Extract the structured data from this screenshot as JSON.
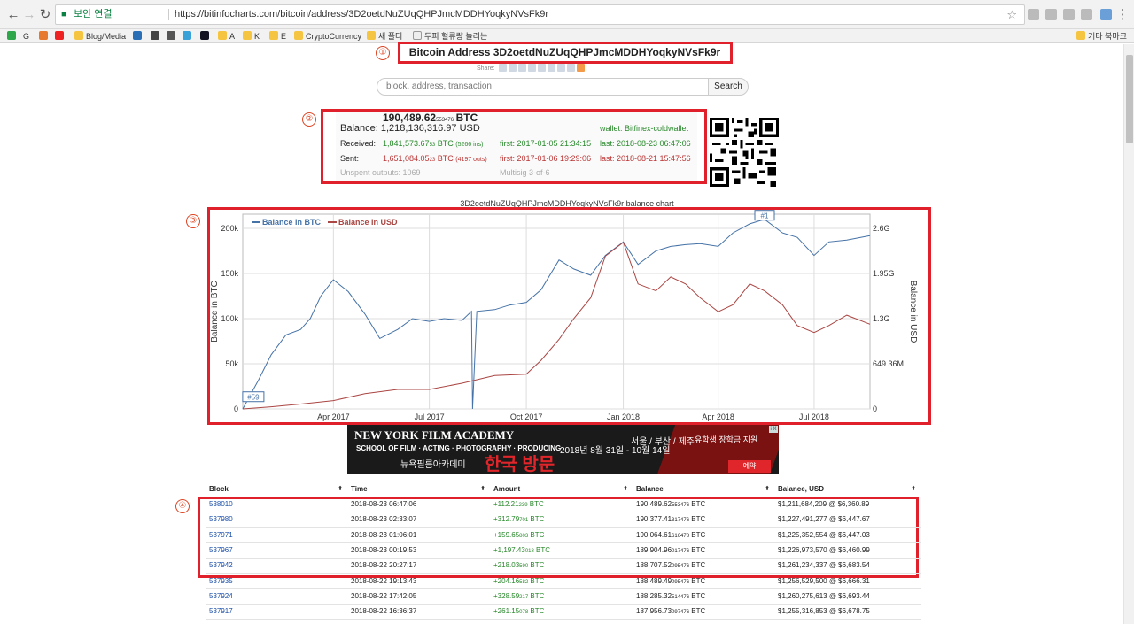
{
  "browser": {
    "secure_label": "보안 연결",
    "url": "https://bitinfocharts.com/bitcoin/address/3D2oetdNuZUqQHPJmcMDDHYoqkyNVsFk9r",
    "bookmarks": [
      "N",
      "G",
      "T",
      "",
      "Blog/Media",
      "",
      "",
      "",
      "",
      "A",
      "K",
      "E",
      "CryptoCurrency",
      "새 폴더",
      "두피 혈류량 늘리는",
      "기타 북마크"
    ]
  },
  "annotations": [
    "①",
    "②",
    "③",
    "④"
  ],
  "page": {
    "title": "Bitcoin Address 3D2oetdNuZUqQHPJmcMDDHYoqkyNVsFk9r",
    "share_label": "Share:",
    "search_placeholder": "block, address, transaction",
    "search_button": "Search"
  },
  "summary": {
    "btc_main": "190,489.62",
    "btc_small": "553476",
    "btc_unit": "BTC",
    "balance_label": "Balance:",
    "usd_balance": "1,218,136,316.97 USD",
    "wallet": "wallet: Bitfinex-coldwallet",
    "received_label": "Received:",
    "received_main": "1,841,573.67",
    "received_small": "53",
    "received_unit": "BTC",
    "received_ins": "(5266 ins)",
    "received_first": "first: 2017-01-05 21:34:15",
    "received_last": "last: 2018-08-23 06:47:06",
    "sent_label": "Sent:",
    "sent_main": "1,651,084.05",
    "sent_small": "23",
    "sent_unit": "BTC",
    "sent_outs": "(4197 outs)",
    "sent_first": "first: 2017-01-06 19:29:06",
    "sent_last": "last: 2018-08-21 15:47:56",
    "unspent": "Unspent outputs: 1069",
    "multisig": "Multisig 3-of-6"
  },
  "chart_data": {
    "type": "line",
    "title": "3D2oetdNuZUqQHPJmcMDDHYoqkyNVsFk9r balance chart",
    "ylabel": "Balance in BTC",
    "y2label": "Balance in USD",
    "yticks": [
      "0",
      "50k",
      "100k",
      "150k",
      "200k"
    ],
    "y2ticks": [
      "0",
      "649.36M",
      "1.3G",
      "1.95G",
      "2.6G"
    ],
    "xticks": [
      "Apr 2017",
      "Jul 2017",
      "Oct 2017",
      "Jan 2018",
      "Apr 2018",
      "Jul 2018"
    ],
    "annotations": [
      "#59",
      "#1"
    ],
    "legend_position": "top-left",
    "ylim": [
      0,
      200000
    ],
    "y2lim": [
      0,
      2600000000
    ],
    "series": [
      {
        "name": "Balance in BTC",
        "color": "#4572a7",
        "axis": "left",
        "x": [
          "2017-01-05",
          "2017-01-20",
          "2017-02-01",
          "2017-02-15",
          "2017-03-01",
          "2017-03-10",
          "2017-03-20",
          "2017-04-01",
          "2017-04-15",
          "2017-05-01",
          "2017-05-15",
          "2017-06-01",
          "2017-06-15",
          "2017-07-01",
          "2017-07-15",
          "2017-08-01",
          "2017-08-10",
          "2017-08-11",
          "2017-08-15",
          "2017-09-01",
          "2017-09-15",
          "2017-10-01",
          "2017-10-15",
          "2017-11-01",
          "2017-11-15",
          "2017-12-01",
          "2017-12-15",
          "2018-01-01",
          "2018-01-15",
          "2018-02-01",
          "2018-02-15",
          "2018-03-01",
          "2018-03-15",
          "2018-04-01",
          "2018-04-15",
          "2018-05-01",
          "2018-05-15",
          "2018-06-01",
          "2018-06-15",
          "2018-07-01",
          "2018-07-15",
          "2018-08-01",
          "2018-08-23"
        ],
        "values": [
          0,
          32000,
          60000,
          82000,
          88000,
          100000,
          125000,
          143000,
          130000,
          105000,
          78000,
          88000,
          100000,
          97000,
          100000,
          98000,
          108000,
          0,
          108000,
          110000,
          115000,
          118000,
          132000,
          165000,
          155000,
          148000,
          170000,
          185000,
          160000,
          175000,
          180000,
          182000,
          183000,
          180000,
          195000,
          205000,
          210000,
          195000,
          190000,
          170000,
          185000,
          187000,
          192000
        ]
      },
      {
        "name": "Balance in USD",
        "color": "#aa4643",
        "axis": "right",
        "x": [
          "2017-01-05",
          "2017-02-01",
          "2017-03-01",
          "2017-04-01",
          "2017-05-01",
          "2017-06-01",
          "2017-07-01",
          "2017-08-01",
          "2017-09-01",
          "2017-10-01",
          "2017-10-15",
          "2017-11-01",
          "2017-11-15",
          "2017-12-01",
          "2017-12-15",
          "2018-01-01",
          "2018-01-15",
          "2018-02-01",
          "2018-02-15",
          "2018-03-01",
          "2018-03-15",
          "2018-04-01",
          "2018-04-15",
          "2018-05-01",
          "2018-05-15",
          "2018-06-01",
          "2018-06-15",
          "2018-07-01",
          "2018-07-15",
          "2018-08-01",
          "2018-08-23"
        ],
        "values": [
          0,
          30000000,
          70000000,
          120000000,
          220000000,
          280000000,
          280000000,
          370000000,
          480000000,
          500000000,
          700000000,
          1000000000,
          1300000000,
          1600000000,
          2200000000,
          2400000000,
          1800000000,
          1700000000,
          1900000000,
          1800000000,
          1600000000,
          1400000000,
          1500000000,
          1800000000,
          1700000000,
          1500000000,
          1200000000,
          1100000000,
          1200000000,
          1350000000,
          1220000000
        ]
      }
    ]
  },
  "ad": {
    "line1": "NEW YORK FILM ACADEMY",
    "line2": "SCHOOL OF FILM · ACTING · PHOTOGRAPHY · PRODUCING",
    "line3": "뉴욕필름아카데미",
    "line4": "한국 방문",
    "line5": "2018년 8월 31일 - 10월 14일",
    "line6": "서울 / 부산 / 제주",
    "line7": "유학생 장학금 지원",
    "cta": "예약",
    "close": "i X"
  },
  "table": {
    "headers": [
      "Block",
      "Time",
      "Amount",
      "Balance",
      "Balance, USD"
    ],
    "rows": [
      {
        "block": "538010",
        "time": "2018-08-23 06:47:06",
        "amount": "+112.21",
        "amount_small": "239",
        "balance": "190,489.62",
        "balance_small": "553476",
        "usd": "$1,211,684,209 @ $6,360.89"
      },
      {
        "block": "537980",
        "time": "2018-08-23 02:33:07",
        "amount": "+312.79",
        "amount_small": "701",
        "balance": "190,377.41",
        "balance_small": "317476",
        "usd": "$1,227,491,277 @ $6,447.67"
      },
      {
        "block": "537971",
        "time": "2018-08-23 01:06:01",
        "amount": "+159.65",
        "amount_small": "803",
        "balance": "190,064.61",
        "balance_small": "616478",
        "usd": "$1,225,352,554 @ $6,447.03"
      },
      {
        "block": "537967",
        "time": "2018-08-23 00:19:53",
        "amount": "+1,197.43",
        "amount_small": "018",
        "balance": "189,904.96",
        "balance_small": "017476",
        "usd": "$1,226,973,570 @ $6,460.99"
      },
      {
        "block": "537942",
        "time": "2018-08-22 20:27:17",
        "amount": "+218.03",
        "amount_small": "590",
        "balance": "188,707.52",
        "balance_small": "095476",
        "usd": "$1,261,234,337 @ $6,683.54"
      },
      {
        "block": "537935",
        "time": "2018-08-22 19:13:43",
        "amount": "+204.16",
        "amount_small": "582",
        "balance": "188,489.49",
        "balance_small": "095476",
        "usd": "$1,256,529,500 @ $6,666.31"
      },
      {
        "block": "537924",
        "time": "2018-08-22 17:42:05",
        "amount": "+328.59",
        "amount_small": "217",
        "balance": "188,285.32",
        "balance_small": "514476",
        "usd": "$1,260,275,613 @ $6,693.44"
      },
      {
        "block": "537917",
        "time": "2018-08-22 16:36:37",
        "amount": "+261.15",
        "amount_small": "078",
        "balance": "187,956.73",
        "balance_small": "097476",
        "usd": "$1,255,316,853 @ $6,678.75"
      }
    ]
  }
}
